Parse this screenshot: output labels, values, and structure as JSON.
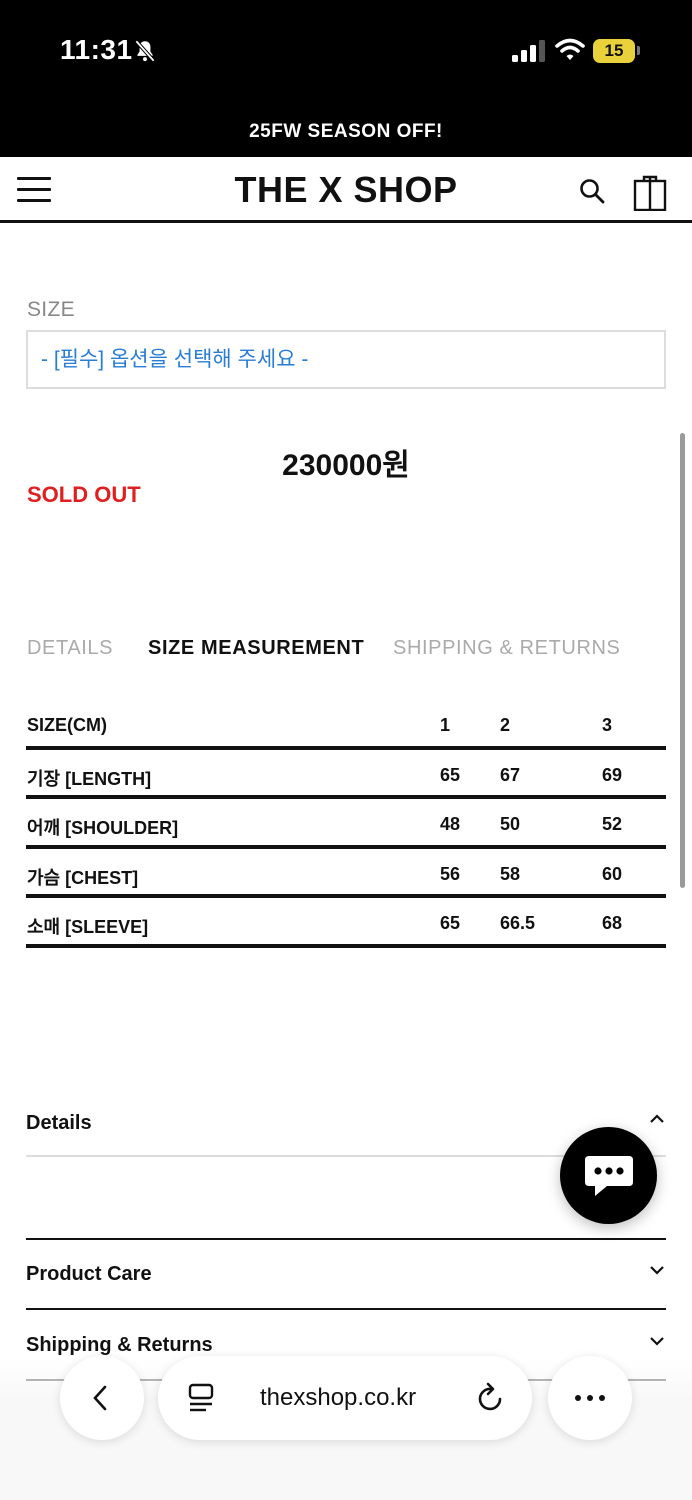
{
  "status_bar": {
    "time": "11:31",
    "battery": "15"
  },
  "promo": {
    "text": "25FW SEASON OFF!"
  },
  "header": {
    "logo": "THE X SHOP"
  },
  "size_option": {
    "label": "SIZE",
    "placeholder": "- [필수] 옵션을 선택해 주세요 -"
  },
  "product": {
    "price": "230000원",
    "status": "SOLD OUT"
  },
  "tabs": [
    {
      "label": "DETAILS",
      "active": false
    },
    {
      "label": "SIZE MEASUREMENT",
      "active": true
    },
    {
      "label": "SHIPPING & RETURNS",
      "active": false
    }
  ],
  "size_table": {
    "headers": [
      "SIZE(CM)",
      "1",
      "2",
      "3"
    ],
    "rows": [
      [
        "기장 [LENGTH]",
        "65",
        "67",
        "69"
      ],
      [
        "어깨 [SHOULDER]",
        "48",
        "50",
        "52"
      ],
      [
        "가슴 [CHEST]",
        "56",
        "58",
        "60"
      ],
      [
        "소매 [SLEEVE]",
        "65",
        "66.5",
        "68"
      ]
    ]
  },
  "accordions": [
    {
      "label": "Details",
      "expanded": true
    },
    {
      "label": "Product Care",
      "expanded": false
    },
    {
      "label": "Shipping & Returns",
      "expanded": false
    }
  ],
  "browser": {
    "url": "thexshop.co.kr"
  },
  "colors": {
    "accent_link": "#2a7dd4",
    "sold_out": "#e02020",
    "battery": "#e8d13a"
  }
}
